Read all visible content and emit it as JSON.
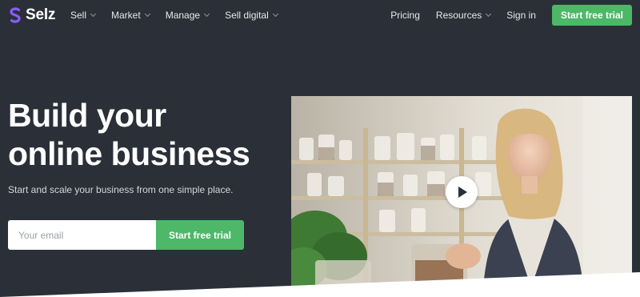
{
  "brand": {
    "name": "Selz",
    "color": "#8b5cf6"
  },
  "nav": {
    "left": [
      {
        "label": "Sell"
      },
      {
        "label": "Market"
      },
      {
        "label": "Manage"
      },
      {
        "label": "Sell digital"
      }
    ],
    "right": {
      "pricing": "Pricing",
      "resources": "Resources",
      "sign_in": "Sign in",
      "cta": "Start free trial"
    }
  },
  "hero": {
    "title_line1": "Build your",
    "title_line2": "online business",
    "subtitle": "Start and scale your business from one simple place.",
    "email_placeholder": "Your email",
    "cta": "Start free trial"
  },
  "video": {
    "play_icon": "play-icon"
  },
  "colors": {
    "background": "#2b3038",
    "accent": "#4cb868",
    "white": "#ffffff"
  }
}
